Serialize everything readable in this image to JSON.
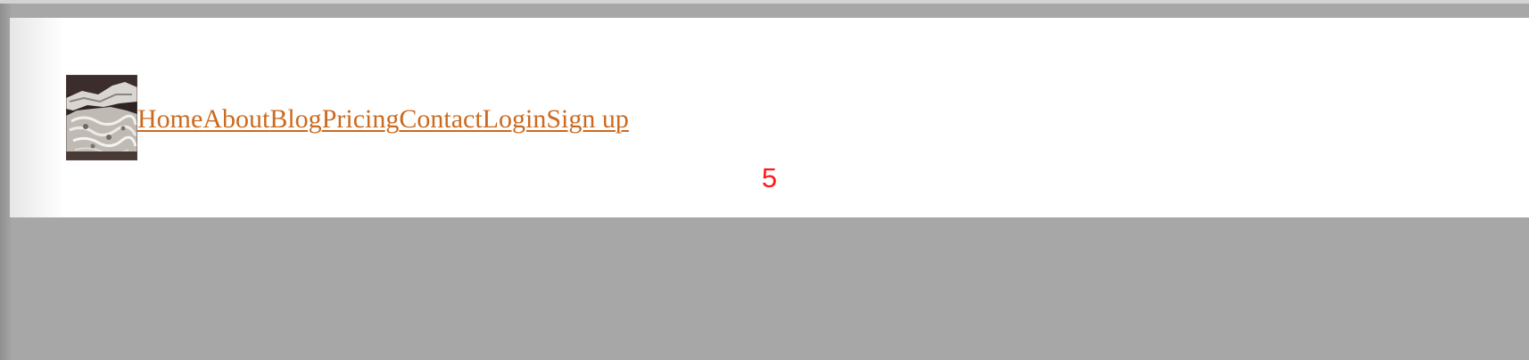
{
  "nav": {
    "items": [
      {
        "label": "Home"
      },
      {
        "label": "About"
      },
      {
        "label": "Blog"
      },
      {
        "label": "Pricing"
      },
      {
        "label": "Contact"
      },
      {
        "label": "Login"
      },
      {
        "label": "Sign up"
      }
    ]
  },
  "counter": {
    "value": "5"
  },
  "colors": {
    "link": "#cc6a1f",
    "counter": "#ff1a1a",
    "background": "#a7a7a7",
    "panel": "#ffffff"
  },
  "logo": {
    "icon": "crystal-rock-photo-icon"
  }
}
